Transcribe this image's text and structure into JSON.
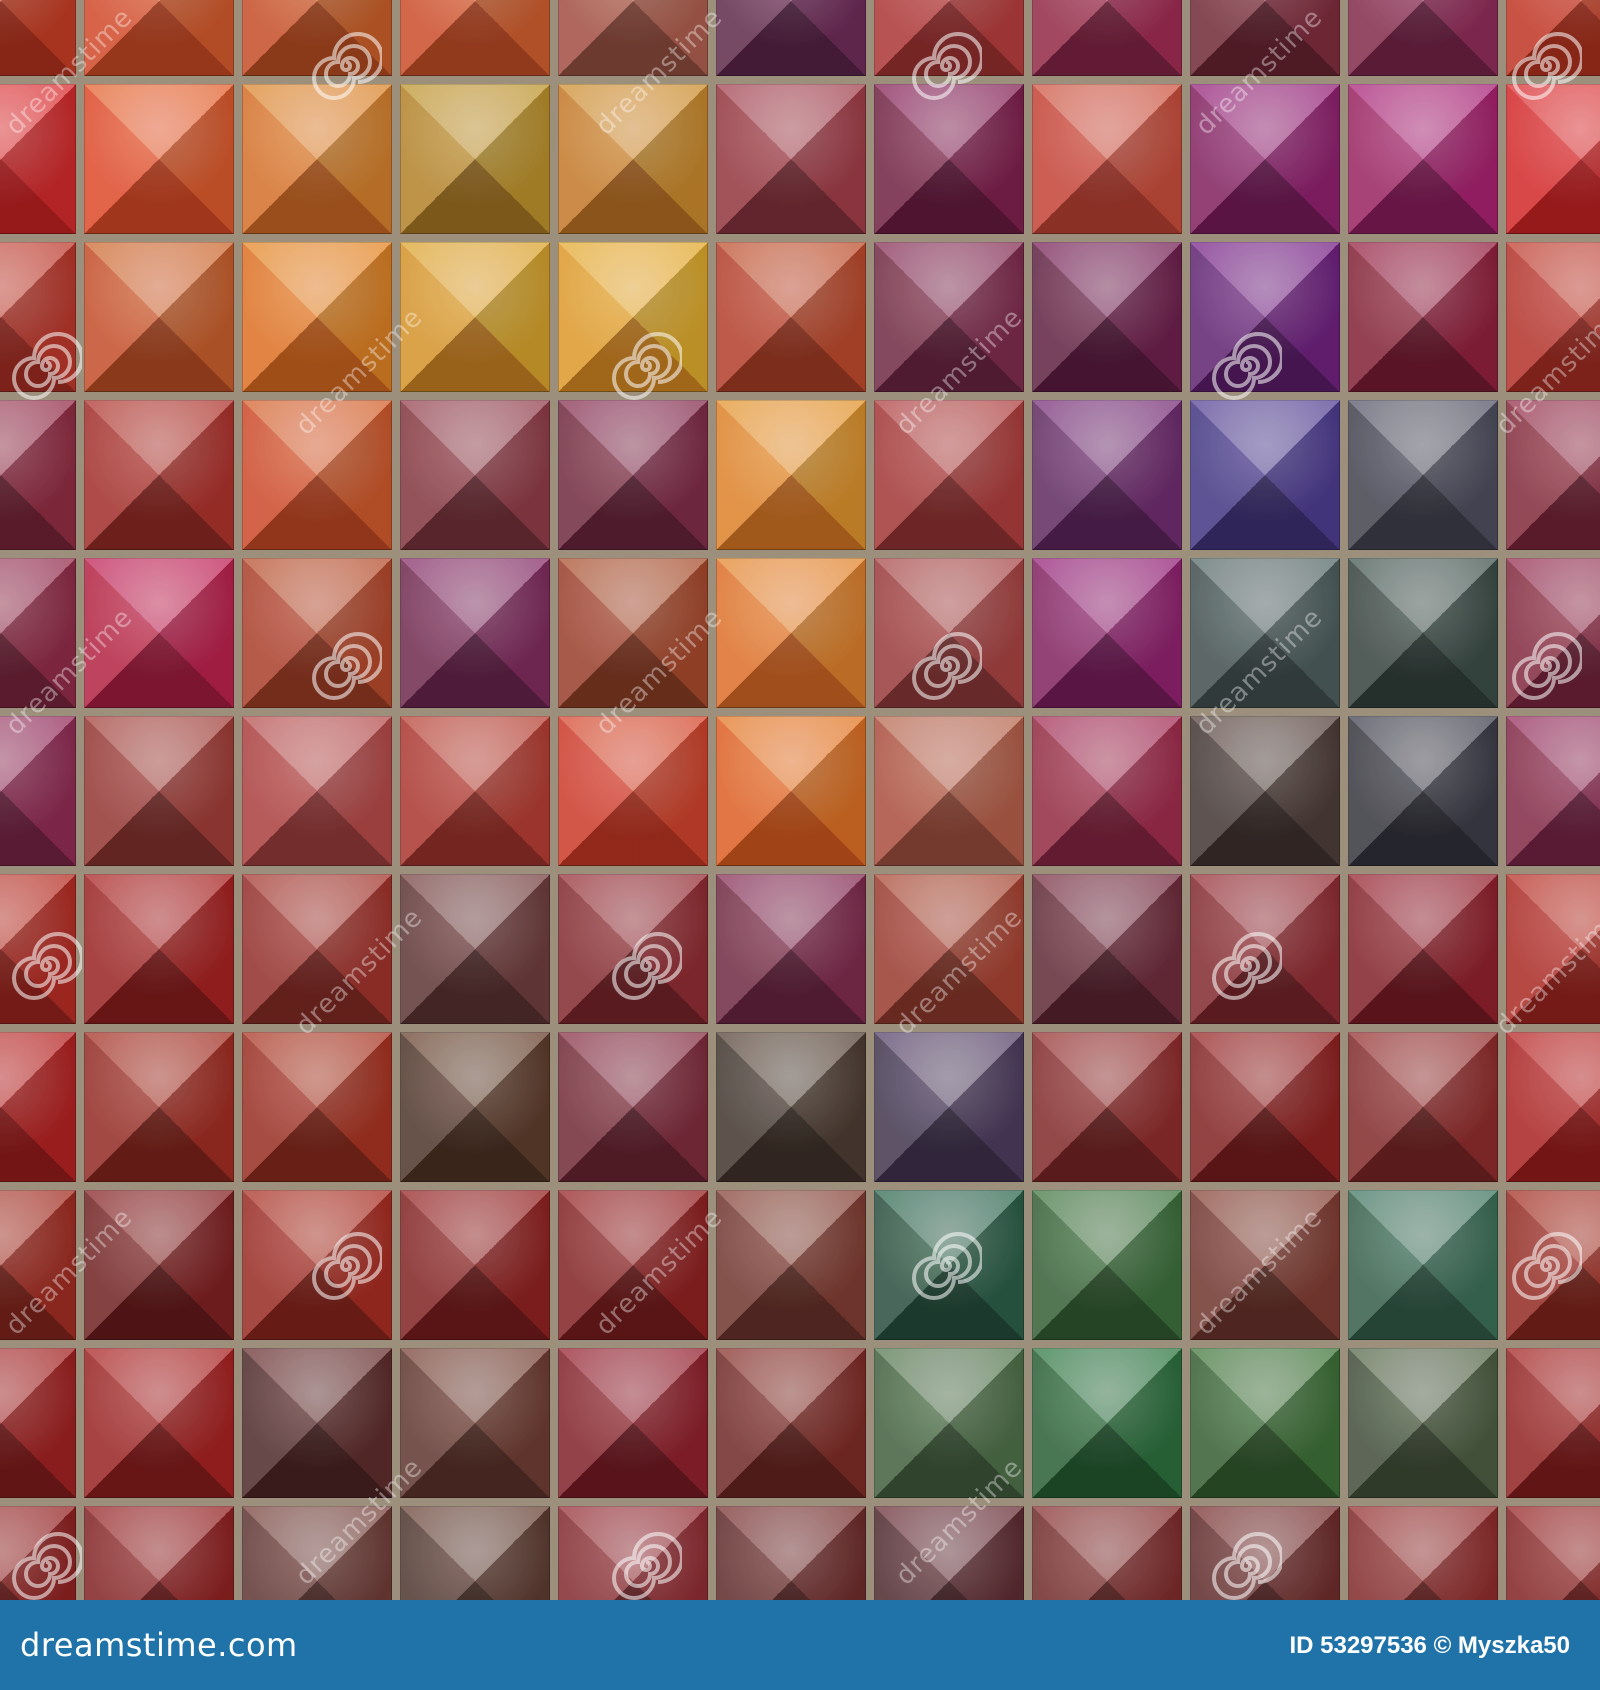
{
  "image": {
    "description_kind": "stock photo of colorful faceted mosaic tiles",
    "grout_color": "#9c8f7c",
    "tile_colors": [
      [
        "#c43a22",
        "#d4552a",
        "#c95a26",
        "#d0592c",
        "#a85a4a",
        "#6a2a55",
        "#b23a3a",
        "#9a2a50",
        "#7a2a3a",
        "#8a2a55"
      ],
      [
        "#d6282a",
        "#e0552a",
        "#d87a2a",
        "#b88a2a",
        "#c8822a",
        "#9a3a45",
        "#7a1f4a",
        "#c84a3a",
        "#8a1f6a",
        "#a0206a"
      ],
      [
        "#b8352a",
        "#c85a2a",
        "#e07a22",
        "#d89a2a",
        "#e0a02a",
        "#b8452a",
        "#7a2a4a",
        "#6a1f4a",
        "#6a207a",
        "#8a1f3a"
      ],
      [
        "#8a2a40",
        "#a8302a",
        "#d0552a",
        "#8a3a45",
        "#7a2a45",
        "#e08a2a",
        "#a83a3a",
        "#6a2a6a",
        "#4a3a8a",
        "#4a4a5a"
      ],
      [
        "#8a2a45",
        "#b8204a",
        "#b0452a",
        "#7a2a5a",
        "#a0452a",
        "#e07a2a",
        "#a04040",
        "#8a206a",
        "#4a5a5a",
        "#3a4a45"
      ],
      [
        "#8a2a50",
        "#9a3a35",
        "#b04545",
        "#b03a30",
        "#d0402a",
        "#e06a22",
        "#b05a45",
        "#9a2a4a",
        "#4a3a35",
        "#3a3a45"
      ],
      [
        "#b02a22",
        "#a02020",
        "#9a302a",
        "#6a3a3a",
        "#8a2a30",
        "#7a2a4a",
        "#a04030",
        "#6a2a3a",
        "#8a2a30",
        "#8a1f2a"
      ],
      [
        "#b02020",
        "#9a2a20",
        "#a03020",
        "#5a3a2a",
        "#7a2a3a",
        "#4a3a30",
        "#4a3a5a",
        "#8a2a2a",
        "#8a2020",
        "#8a2a2a"
      ],
      [
        "#9a2a20",
        "#7a1f20",
        "#a02a20",
        "#8a2020",
        "#8a1f20",
        "#7a3a30",
        "#2a5a45",
        "#3a6a3a",
        "#7a3a30",
        "#3a6a55"
      ],
      [
        "#9a2020",
        "#a02020",
        "#5a2a2a",
        "#6a3a30",
        "#8a1f2a",
        "#7a2a25",
        "#4a6a45",
        "#2a6a3a",
        "#3a6a35",
        "#4a5a40"
      ],
      [
        "#8a2020",
        "#8a1f20",
        "#6a3a35",
        "#5a3a30",
        "#8a2a30",
        "#6a2a2a",
        "#5a2a30",
        "#7a2a2a",
        "#6a2a2a",
        "#8a2a2a"
      ]
    ],
    "watermark": {
      "icon": "spiral-logo-icon",
      "text": "dreamstime"
    }
  },
  "footer": {
    "brand": "dreamstime.com",
    "image_id": "ID 53297536 © Myszka50"
  }
}
